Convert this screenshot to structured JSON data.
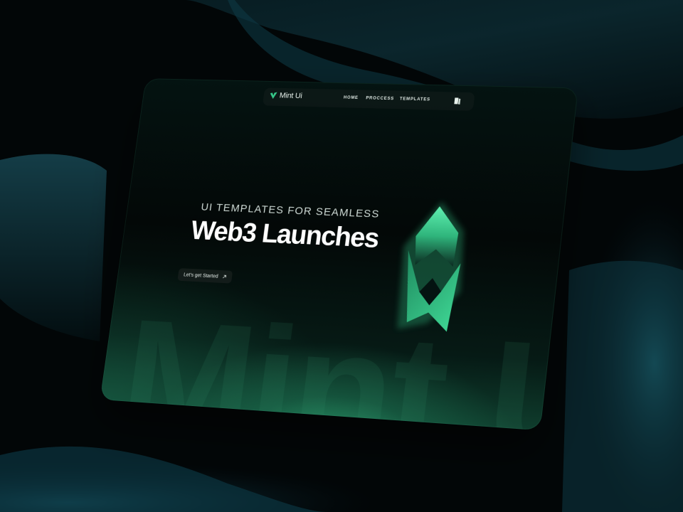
{
  "brand": {
    "name": "Mint Ui"
  },
  "nav": {
    "links": [
      {
        "label": "HOME"
      },
      {
        "label": "PROCCESS"
      },
      {
        "label": "TEMPLATES"
      }
    ]
  },
  "hero": {
    "tagline": "UI TEMPLATES FOR SEAMLESS",
    "headline": "Web3 Launches",
    "cta_label": "Let's get Started",
    "background_word": "Mint Ui"
  },
  "icons": {
    "logo": "mint-leaf-icon",
    "nav_action": "book-icon",
    "cta": "arrow-up-right-icon",
    "emblem": "mint-emblem-icon"
  },
  "colors": {
    "accent": "#36c98a",
    "accent_dark": "#1b7a55",
    "background": "#020607",
    "surface": "#041311",
    "text": "#ffffff",
    "backdrop_wave": "#0e3a44"
  }
}
